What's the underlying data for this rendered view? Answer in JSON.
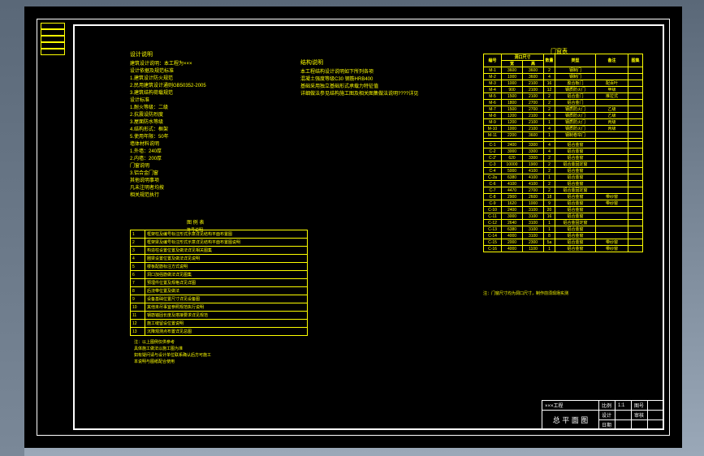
{
  "folding": [
    "",
    "",
    "",
    "",
    ""
  ],
  "notes1_title": "设计说明",
  "notes1": [
    "建筑设计说明：本工程为×××",
    "设计依据及规范标准",
    "1.建筑设计防火规范",
    "2.民用建筑设计通则GB50352-2005",
    "3.建筑结构荷载规范",
    "设计标准",
    "1.耐火等级：二级",
    "2.抗震设防烈度",
    "3.屋面防水等级",
    "4.结构形式：框架",
    "5.使用年限：50年",
    "墙体材料说明",
    "1.外墙：240厚",
    "2.内墙：200厚",
    "门窗说明",
    "3.铝合金门窗",
    "其他说明事项",
    "凡未注明者均按",
    "相关规范执行"
  ],
  "notes2_title": "结构说明",
  "notes2": [
    "本工程结构设计说明如下所列各项",
    "混凝土强度等级C30      钢筋HRB400",
    "基础采用独立基础形式承载力特征值",
    "详细做法参见结构施工图及相关图集做法说明????详见"
  ],
  "legend_title": "图 例 表",
  "legend_sub": "符号说明",
  "legend": [
    [
      "1",
      "框架柱及编号标注形式示意详见结构平面布置图"
    ],
    [
      "2",
      "框架梁及编号标注形式示意详见结构平面布置图说明"
    ],
    [
      "3",
      "构造柱设置位置及做法详见相关图集"
    ],
    [
      "4",
      "圈梁设置位置及做法详见说明"
    ],
    [
      "5",
      "楼板配筋标注方式说明"
    ],
    [
      "6",
      "洞口加强筋做法详见图集"
    ],
    [
      "7",
      "预埋件位置及规格详见详图"
    ],
    [
      "8",
      "后浇带位置及做法"
    ],
    [
      "9",
      "设备基础位置尺寸详见设备图"
    ],
    [
      "10",
      "其他未尽事宜参照规范执行说明"
    ],
    [
      "11",
      "钢筋锚固长度及搭接要求详见规范"
    ],
    [
      "12",
      "施工缝留设位置说明"
    ],
    [
      "13",
      "沉降观测点布置详见总图"
    ]
  ],
  "notes3": [
    "注：以上图例仅供参考",
    "具体施工做法以施工图为准",
    "如有疑问请与设计单位联系确认后方可施工",
    "本说明与图纸配合使用"
  ],
  "data_title": "门窗表",
  "data_headers": {
    "tag": "编号",
    "dim": "洞口尺寸",
    "w": "宽",
    "h": "高",
    "n": "数量",
    "type": "类型",
    "remark": "备注",
    "extra": "图集"
  },
  "data_rows": [
    [
      "M-1",
      "3600",
      "3600",
      "2",
      "钢制门",
      "",
      ""
    ],
    [
      "M-2",
      "1000",
      "3600",
      "4",
      "钢制门",
      "",
      ""
    ],
    [
      "M-3",
      "1000",
      "2100",
      "16",
      "胶合板门",
      "配百叶",
      ""
    ],
    [
      "M-4",
      "900",
      "2100",
      "12",
      "钢质防火门",
      "甲级",
      ""
    ],
    [
      "M-5",
      "1500",
      "2100",
      "2",
      "铝合金门",
      "推拉式",
      ""
    ],
    [
      "M-6",
      "1800",
      "2700",
      "2",
      "铝合金门",
      "",
      ""
    ],
    [
      "M-7",
      "1500",
      "2700",
      "2",
      "钢质防火门",
      "乙级",
      ""
    ],
    [
      "M-8",
      "1200",
      "2100",
      "4",
      "钢质防火门",
      "乙级",
      ""
    ],
    [
      "M-9",
      "1200",
      "2100",
      "1",
      "钢质防火门",
      "丙级",
      ""
    ],
    [
      "M-10",
      "1000",
      "2100",
      "4",
      "钢质防火门",
      "丙级",
      ""
    ],
    [
      "M-11",
      "2200",
      "3600",
      "1",
      "钢制卷帘门",
      "",
      ""
    ]
  ],
  "data_rows2": [
    [
      "C-1",
      "2400",
      "3300",
      "4",
      "铝合金窗",
      "",
      ""
    ],
    [
      "C-2",
      "3000",
      "3300",
      "4",
      "铝合金窗",
      "",
      ""
    ],
    [
      "C-2'",
      "620",
      "3300",
      "2",
      "铝合金窗",
      "",
      ""
    ],
    [
      "C-3",
      "10000",
      "1900",
      "2",
      "铝合金固定窗",
      "",
      ""
    ],
    [
      "C-4",
      "5000",
      "4100",
      "2",
      "铝合金窗",
      "",
      ""
    ],
    [
      "C-2a",
      "6380",
      "4100",
      "1",
      "铝合金窗",
      "",
      ""
    ],
    [
      "C-6",
      "4100",
      "4100",
      "2",
      "铝合金窗",
      "",
      ""
    ],
    [
      "C-7",
      "4470",
      "2700",
      "2",
      "铝合金固定窗",
      "",
      ""
    ],
    [
      "C-8",
      "2900",
      "2600",
      "18",
      "铝合金窗",
      "带纱窗",
      ""
    ],
    [
      "C-9",
      "1620",
      "1000",
      "9",
      "铝合金窗",
      "带纱窗",
      ""
    ],
    [
      "C-10",
      "2400",
      "3100",
      "20",
      "铝合金窗",
      "",
      ""
    ],
    [
      "C-11",
      "3000",
      "3100",
      "16",
      "铝合金窗",
      "",
      ""
    ],
    [
      "C-12",
      "2640",
      "3100",
      "1",
      "铝合金固定窗",
      "",
      ""
    ],
    [
      "C-13",
      "6380",
      "3100",
      "1",
      "铝合金窗",
      "",
      ""
    ],
    [
      "C-14",
      "4000",
      "3100",
      "8",
      "铝合金窗",
      "",
      ""
    ],
    [
      "C-15",
      "2000",
      "2300",
      "5a",
      "铝合金窗",
      "带纱窗",
      ""
    ],
    [
      "C-16",
      "4000",
      "1100",
      "1",
      "铝合金窗",
      "带纱窗",
      ""
    ]
  ],
  "data_footer": "注：门窗尺寸均为洞口尺寸，制作前须现场实测",
  "titleblock": {
    "project": "×××工程",
    "drawing": "总 平 面 图",
    "scale": "比例",
    "scale_v": "1:1",
    "sheet": "图号",
    "design": "设计",
    "check": "审核",
    "date": "日期"
  }
}
